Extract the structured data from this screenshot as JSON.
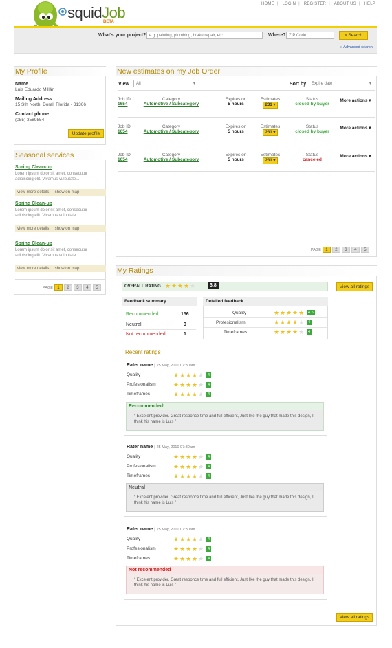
{
  "topnav": {
    "home": "HOME",
    "login": "LOGIN",
    "register": "REGISTER",
    "about": "ABOUT US",
    "help": "HELP"
  },
  "brand": {
    "name_a": "squid",
    "name_b": "Job",
    "beta": "BETA"
  },
  "search": {
    "project_label": "What's your project?",
    "project_placeholder": "e.g. painting, plumbing, brake repair, etc...",
    "where_label": "Where?",
    "zip_placeholder": "ZIP Code",
    "button": "Search",
    "advanced": "» Advanced search"
  },
  "profile": {
    "title": "My Profile",
    "name_label": "Name",
    "name": "Luis Eduardo Millán",
    "address_label": "Mailing Address",
    "address": "15 Sth North, Doral, Florida - 31366",
    "phone_label": "Contact phone",
    "phone": "(055) 3589854",
    "update": "Update profile"
  },
  "seasonal": {
    "title": "Seasonal services",
    "items": [
      {
        "title": "Spring Clean-up",
        "desc": "Lorem ipsum dolor sit amet, consecutur adipiscing elit. Vivamus vulputate...",
        "more": "view more details",
        "map": "show on map"
      },
      {
        "title": "Spring Clean-up",
        "desc": "Lorem ipsum dolor sit amet, consecutur adipiscing elit. Vivamus vulputate...",
        "more": "view more details",
        "map": "show on map"
      },
      {
        "title": "Spring Clean-up",
        "desc": "Lorem ipsum dolor sit amet, consecutur adipiscing elit. Vivamus vulputate...",
        "more": "view more details",
        "map": "show on map"
      }
    ],
    "page_label": "PAGE",
    "pages": [
      "1",
      "2",
      "3",
      "4",
      "5"
    ]
  },
  "estimates": {
    "title": "New estimates on my Job Order",
    "view_label": "View",
    "view_value": "All",
    "sort_label": "Sort by",
    "sort_value": "Expire date",
    "headers": {
      "job": "Job ID",
      "category": "Category",
      "expires": "Expires on",
      "estimates": "Estimates",
      "status": "Status"
    },
    "rows": [
      {
        "job": "1654",
        "category": "Automotive / Subcategory",
        "expires": "5 hours",
        "estimates": "231 ▾",
        "status": "closed by buyer",
        "actions": "More actions ▾"
      },
      {
        "job": "1654",
        "category": "Automotive / Subcategory",
        "expires": "5 hours",
        "estimates": "231 ▾",
        "status": "closed by buyer",
        "actions": "More actions ▾"
      },
      {
        "job": "1654",
        "category": "Automotive / Subcategory",
        "expires": "5 hours",
        "estimates": "231 ▾",
        "status": "canceled",
        "actions": "More actions ▾"
      }
    ],
    "page_label": "PAGE",
    "pages": [
      "1",
      "2",
      "3",
      "4",
      "5"
    ]
  },
  "ratings": {
    "title": "My Ratings",
    "overall_label": "OVERALL RATING",
    "overall_score": "3.8",
    "overall_stars": 3.5,
    "view_all": "View all ratings",
    "summary": {
      "title": "Feedback summary",
      "rows": [
        {
          "label": "Recommended",
          "count": "156"
        },
        {
          "label": "Neutral",
          "count": "3"
        },
        {
          "label": "Not recommended",
          "count": "1"
        }
      ]
    },
    "detailed": {
      "title": "Detailed feedback",
      "rows": [
        {
          "label": "Quality",
          "score": "4.5",
          "stars": 4.5
        },
        {
          "label": "Profesionalism",
          "score": "4",
          "stars": 4
        },
        {
          "label": "Timeframes",
          "score": "4",
          "stars": 4
        }
      ]
    },
    "recent_title": "Recent ratings",
    "recent": [
      {
        "rater": "Rater name",
        "date": "25 May, 2010 07:30am",
        "verdict": "Recommended!",
        "quote": "Excelent provider. Great responce time and full efficient, Just like the guy that made this design, I think his name is Luis"
      },
      {
        "rater": "Rater name",
        "date": "25 May, 2010 07:30am",
        "verdict": "Neutral",
        "quote": "Excelent provider. Great responce time and full efficient, Just like the guy that made this design, I think his name is Luis"
      },
      {
        "rater": "Rater name",
        "date": "25 May, 2010 07:30am",
        "verdict": "Not recommended",
        "quote": "Excelent provider. Great responce time and full efficient, Just like the guy that made this design, I think his name is Luis"
      }
    ],
    "criteria": [
      "Quality",
      "Profesionalism",
      "Timeframes"
    ],
    "criteria_score": "4",
    "view_all_bottom": "View all ratings"
  },
  "colors": {
    "accent": "#f2cc1a",
    "heading": "#b38a00",
    "link": "#2e7d2e",
    "good": "#3daa3d",
    "bad": "#cc2222"
  }
}
